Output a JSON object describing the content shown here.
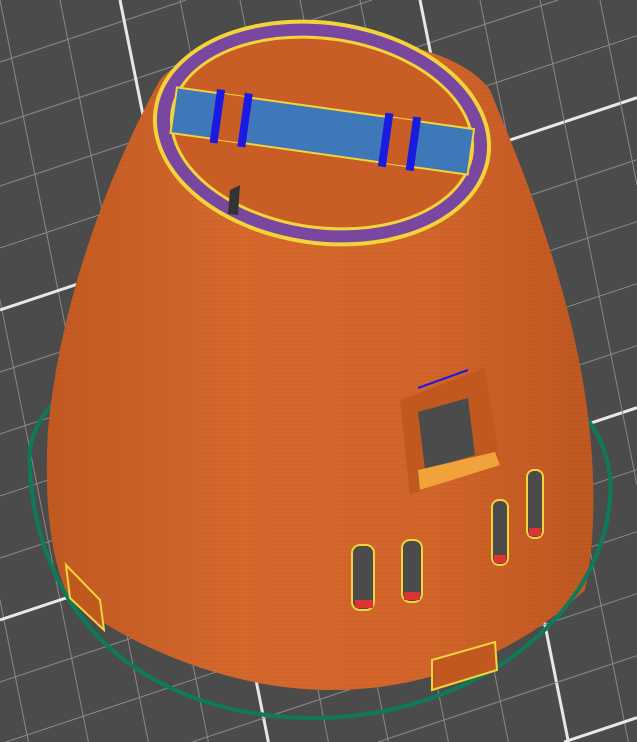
{
  "viewport": {
    "background_color": "#4b4b4b",
    "grid_color": "#8a8a8a",
    "grid_major_color": "#e8e8e8"
  },
  "model": {
    "body_color": "#d2652a",
    "body_shade_color": "#b9531e",
    "top_ring_color": "#7a47a0",
    "top_ring_edge_color": "#f2d43a",
    "infill_color": "#3f78b8",
    "bridge_color": "#1a1ae0",
    "skirt_color": "#0f7a5a"
  }
}
